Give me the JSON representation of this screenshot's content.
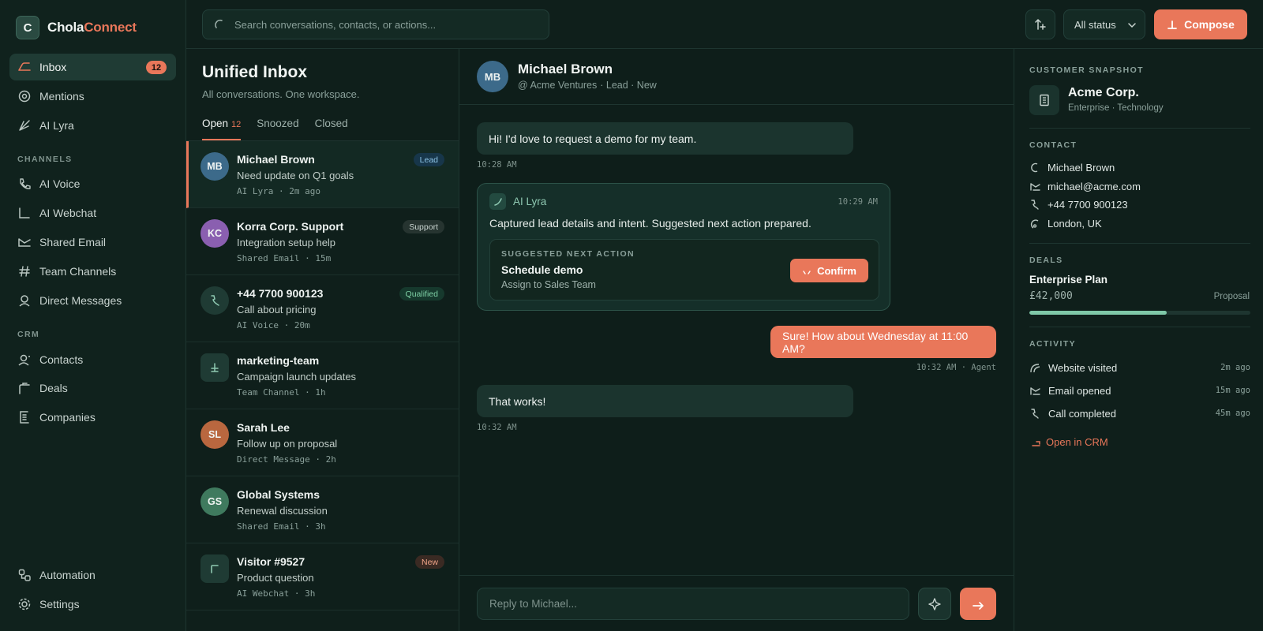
{
  "brand": {
    "logo_letter": "C",
    "name_part1": "Chola",
    "name_part2": "Connect"
  },
  "colors": {
    "accent": "#e9775a",
    "background": "#0d1b17",
    "success": "#7fc8a8"
  },
  "sidebar": {
    "main": [
      {
        "label": "Inbox",
        "icon": "inbox-icon",
        "badge": "12",
        "active": true
      },
      {
        "label": "Mentions",
        "icon": "at-sign-icon"
      },
      {
        "label": "AI Lyra",
        "icon": "sparkle-icon"
      }
    ],
    "channels_heading": "CHANNELS",
    "channels": [
      {
        "label": "AI Voice",
        "icon": "phone-icon"
      },
      {
        "label": "AI Webchat",
        "icon": "chat-icon"
      },
      {
        "label": "Shared Email",
        "icon": "mail-icon"
      },
      {
        "label": "Team Channels",
        "icon": "hash-icon"
      },
      {
        "label": "Direct Messages",
        "icon": "user-icon"
      }
    ],
    "crm_heading": "CRM",
    "crm": [
      {
        "label": "Contacts",
        "icon": "contacts-icon"
      },
      {
        "label": "Deals",
        "icon": "briefcase-icon"
      },
      {
        "label": "Companies",
        "icon": "building-icon"
      }
    ],
    "bottom": [
      {
        "label": "Automation",
        "icon": "automation-icon"
      },
      {
        "label": "Settings",
        "icon": "gear-icon"
      }
    ]
  },
  "topbar": {
    "search_placeholder": "Search conversations, contacts, or actions...",
    "status_select": "All status",
    "compose_label": "Compose"
  },
  "inbox": {
    "title": "Unified Inbox",
    "subtitle": "All conversations. One workspace.",
    "tabs": [
      {
        "label": "Open",
        "count": "12",
        "active": true
      },
      {
        "label": "Snoozed"
      },
      {
        "label": "Closed"
      }
    ],
    "conversations": [
      {
        "initials": "MB",
        "name": "Michael Brown",
        "preview": "Need update on Q1 goals",
        "meta": "AI Lyra · 2m ago",
        "tag": "Lead"
      },
      {
        "initials": "KC",
        "name": "Korra Corp. Support",
        "preview": "Integration setup help",
        "meta": "Shared Email · 15m",
        "tag": "Support"
      },
      {
        "initials": "",
        "name": "+44 7700 900123",
        "preview": "Call about pricing",
        "meta": "AI Voice · 20m",
        "tag": "Qualified"
      },
      {
        "initials": "",
        "name": "marketing-team",
        "preview": "Campaign launch updates",
        "meta": "Team Channel · 1h",
        "tag": ""
      },
      {
        "initials": "SL",
        "name": "Sarah Lee",
        "preview": "Follow up on proposal",
        "meta": "Direct Message · 2h",
        "tag": ""
      },
      {
        "initials": "GS",
        "name": "Global Systems",
        "preview": "Renewal discussion",
        "meta": "Shared Email · 3h",
        "tag": ""
      },
      {
        "initials": "",
        "name": "Visitor #9527",
        "preview": "Product question",
        "meta": "AI Webchat · 3h",
        "tag": "New"
      }
    ]
  },
  "chat": {
    "contact_initials": "MB",
    "contact_name": "Michael Brown",
    "contact_company": "@ Acme Ventures",
    "contact_status": "· Lead · New",
    "messages": [
      {
        "text": "Hi! I'd love to request a demo for my team.",
        "time": "10:28 AM"
      },
      {
        "text": "Sure! How about Wednesday at 11:00 AM?",
        "time": "10:32 AM · Agent"
      },
      {
        "text": "That works!",
        "time": "10:32 AM"
      }
    ],
    "ai": {
      "name": "AI Lyra",
      "time": "10:29 AM",
      "text": "Captured lead details and intent. Suggested next action prepared.",
      "suggest_label": "SUGGESTED NEXT ACTION",
      "suggest_title": "Schedule demo",
      "suggest_sub": "Assign to Sales Team",
      "confirm_label": "Confirm"
    },
    "reply_placeholder": "Reply to Michael..."
  },
  "snapshot": {
    "heading": "CUSTOMER SNAPSHOT",
    "company": "Acme Corp.",
    "company_sub": "Enterprise · Technology",
    "contact_heading": "CONTACT",
    "contact": [
      {
        "icon": "user-icon",
        "text": "Michael Brown"
      },
      {
        "icon": "mail-icon",
        "text": "michael@acme.com"
      },
      {
        "icon": "phone-icon",
        "text": "+44 7700 900123"
      },
      {
        "icon": "location-icon",
        "text": "London, UK"
      }
    ],
    "deals_heading": "DEALS",
    "deal_name": "Enterprise Plan",
    "deal_amount": "£42,000",
    "deal_stage": "Proposal",
    "deal_progress": 0.62,
    "activity_heading": "ACTIVITY",
    "activity": [
      {
        "icon": "globe-icon",
        "text": "Website visited",
        "time": "2m ago"
      },
      {
        "icon": "mail-icon",
        "text": "Email opened",
        "time": "15m ago"
      },
      {
        "icon": "phone-icon",
        "text": "Call completed",
        "time": "45m ago"
      }
    ],
    "crm_link": "Open in CRM"
  }
}
